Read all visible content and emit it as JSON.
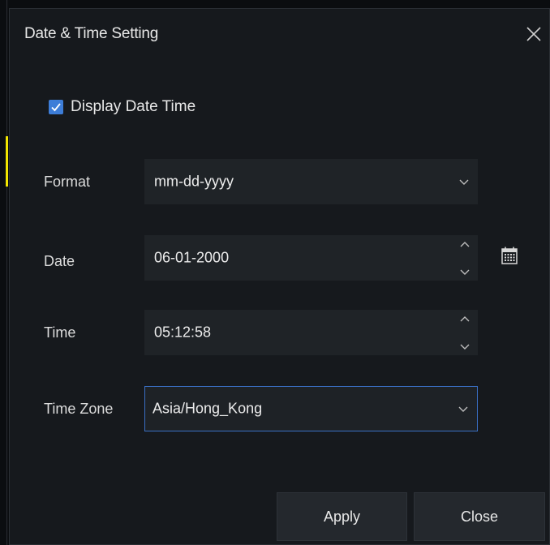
{
  "dialog": {
    "title": "Date & Time Setting"
  },
  "display_date_time": {
    "label": "Display Date Time",
    "checked": true
  },
  "format": {
    "label": "Format",
    "value": "mm-dd-yyyy"
  },
  "date": {
    "label": "Date",
    "value": "06-01-2000"
  },
  "time": {
    "label": "Time",
    "value": "05:12:58"
  },
  "time_zone": {
    "label": "Time Zone",
    "value": "Asia/Hong_Kong"
  },
  "buttons": {
    "apply": "Apply",
    "close": "Close"
  },
  "icons": {
    "close": "close-icon",
    "checkbox": "check-icon",
    "dropdown": "chevron-down-icon",
    "spin_up": "chevron-up-icon",
    "calendar": "calendar-icon"
  },
  "colors": {
    "accent": "#3d7dd8",
    "focus_border": "#3a6fc4",
    "dialog_bg": "#16191d",
    "field_bg": "#1f2327"
  }
}
